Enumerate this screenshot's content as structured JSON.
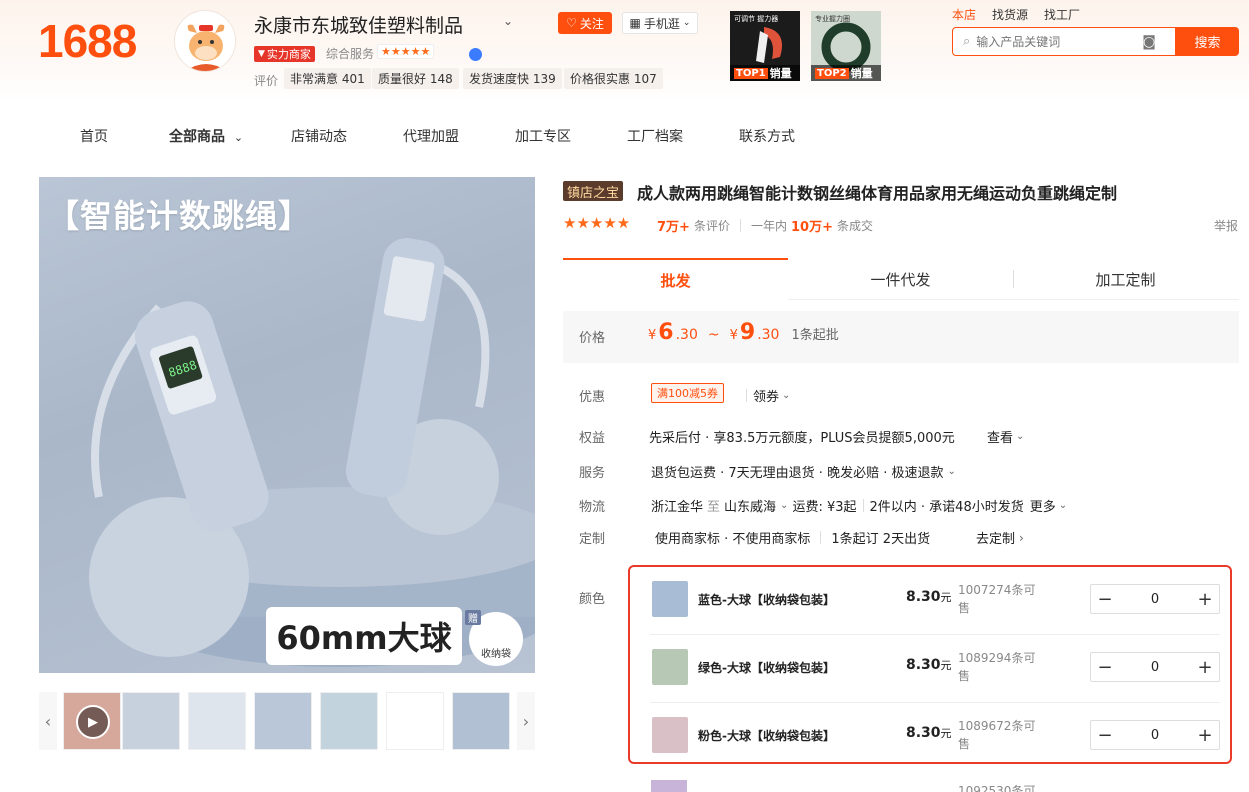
{
  "brand": {
    "logo": "1688"
  },
  "shop": {
    "name": "永康市东城致佳塑料制品",
    "follow_label": "关注",
    "mobile_label": "手机逛",
    "merchant_badge": "实力商家",
    "service_label": "综合服务",
    "service_stars": "★★★★★",
    "eval_label": "评价",
    "eval_tags": [
      "非常满意 401",
      "质量很好 148",
      "发货速度快 139",
      "价格很实惠 107"
    ]
  },
  "top_products": [
    {
      "rank_label": "TOP1",
      "suffix": "销量",
      "caption": "可调节 握力器"
    },
    {
      "rank_label": "TOP2",
      "suffix": "销量",
      "caption": "专业握力圈"
    }
  ],
  "top_links": [
    "本店",
    "找货源",
    "找工厂"
  ],
  "search": {
    "placeholder": "输入产品关键词",
    "button": "搜索"
  },
  "nav": [
    "首页",
    "全部商品",
    "店铺动态",
    "代理加盟",
    "加工专区",
    "工厂档案",
    "联系方式"
  ],
  "main_image": {
    "headline": "【智能计数跳绳】",
    "big_label": "60mm大球",
    "gift_tag": "赠",
    "gift_text": "收纳袋"
  },
  "product": {
    "badge": "镇店之宝",
    "title": "成人款两用跳绳智能计数钢丝绳体育用品家用无绳运动负重跳绳定制",
    "stars": "★★★★★",
    "review_count": "7万+",
    "review_suffix": "条评价",
    "year_label": "一年内",
    "deal_count": "10万+",
    "deal_suffix": "条成交",
    "report": "举报"
  },
  "tabs": [
    "批发",
    "一件代发",
    "加工定制"
  ],
  "price": {
    "label": "价格",
    "symbol": "¥",
    "low_int": "6",
    "low_dec": ".30",
    "high_int": "9",
    "high_dec": ".30",
    "min_order": "1条起批"
  },
  "rows": {
    "discount_label": "优惠",
    "coupon": "满100减5券",
    "get_coupon": "领券",
    "rights_label": "权益",
    "rights_text": "先采后付 · 享83.5万元额度，PLUS会员提额5,000元",
    "rights_more": "查看",
    "service_label": "服务",
    "service_text": "退货包运费 · 7天无理由退货 · 晚发必赔 · 极速退款",
    "logistics_label": "物流",
    "logistics_from": "浙江金华",
    "logistics_to_word": "至",
    "logistics_to": "山东威海",
    "logistics_fee": "运费: ¥3起",
    "logistics_promise": "2件以内 · 承诺48小时发货",
    "logistics_more": "更多",
    "custom_label": "定制",
    "custom_text": "使用商家标 · 不使用商家标",
    "custom_time": "1条起订 2天出货",
    "custom_go": "去定制",
    "color_label": "颜色"
  },
  "skus": [
    {
      "name": "蓝色-大球【收纳袋包装】",
      "price": "8.30",
      "unit": "元",
      "stock": "1007274条可售",
      "qty": "0",
      "color": "#a8bcd6"
    },
    {
      "name": "绿色-大球【收纳袋包装】",
      "price": "8.30",
      "unit": "元",
      "stock": "1089294条可售",
      "qty": "0",
      "color": "#b7c9b4"
    },
    {
      "name": "粉色-大球【收纳袋包装】",
      "price": "8.30",
      "unit": "元",
      "stock": "1089672条可售",
      "qty": "0",
      "color": "#d9c0c7"
    }
  ],
  "sku_partial_stock": "1092530条可"
}
